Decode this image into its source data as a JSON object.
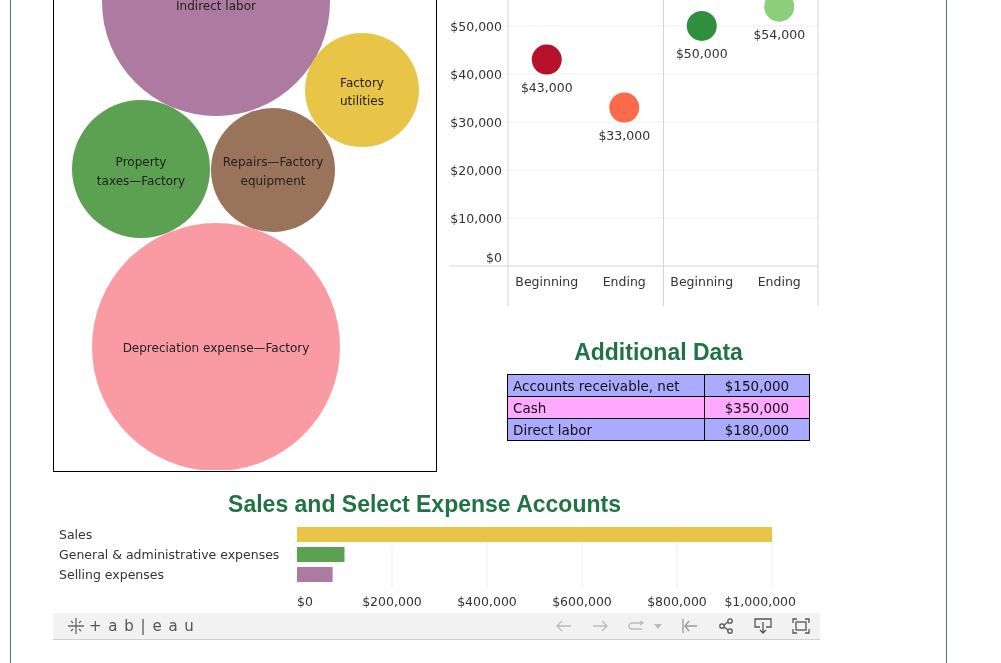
{
  "bubble_chart": {
    "bubbles": [
      {
        "label": "Indirect labor",
        "color": "#ad7aa1"
      },
      {
        "label": "Factory utilities",
        "color": "#e8c547"
      },
      {
        "label": "Property taxes—Factory",
        "color": "#5ba151"
      },
      {
        "label": "Repairs—Factory equipment",
        "color": "#9a735b"
      },
      {
        "label": "Depreciation expense—Factory",
        "color": "#fa9ba4"
      }
    ]
  },
  "balance_chart": {
    "chart_data": {
      "type": "scatter",
      "categories": [
        "Beginning",
        "Ending",
        "Beginning",
        "Ending"
      ],
      "ylim": [
        0,
        55400
      ],
      "yticks": [
        {
          "value": 0,
          "label": "$0"
        },
        {
          "value": 10000,
          "label": "$10,000"
        },
        {
          "value": 20000,
          "label": "$20,000"
        },
        {
          "value": 30000,
          "label": "$30,000"
        },
        {
          "value": 40000,
          "label": "$40,000"
        },
        {
          "value": 50000,
          "label": "$50,000"
        }
      ],
      "series": [
        {
          "color": "#b5112a",
          "values": [
            43000,
            null,
            null,
            null
          ]
        },
        {
          "color": "#fb6a4a",
          "values": [
            null,
            33000,
            null,
            null
          ]
        },
        {
          "color": "#2f8f3e",
          "values": [
            null,
            null,
            50000,
            null
          ]
        },
        {
          "color": "#8ccf7a",
          "values": [
            null,
            null,
            null,
            54000
          ]
        }
      ],
      "value_labels": [
        "$43,000",
        "$33,000",
        "$50,000",
        "$54,000"
      ],
      "grid": true
    }
  },
  "additional_data": {
    "title": "Additional Data",
    "rows": [
      {
        "label": "Accounts receivable, net",
        "value": "$150,000",
        "color": "#aaaaff"
      },
      {
        "label": "Cash",
        "value": "$350,000",
        "color": "#ffaaff"
      },
      {
        "label": "Direct labor",
        "value": "$180,000",
        "color": "#aaaaff"
      }
    ]
  },
  "sales_chart": {
    "chart_data": {
      "type": "bar",
      "orientation": "horizontal",
      "title": "Sales and Select Expense Accounts",
      "grid": true,
      "categories": [
        "Sales",
        "General & administrative expenses",
        "Selling expenses"
      ],
      "series": [
        {
          "color": "#e8c547",
          "values": [
            1000000,
            null,
            null
          ]
        },
        {
          "color": "#5ba151",
          "values": [
            null,
            100000,
            null
          ]
        },
        {
          "color": "#ad7aa1",
          "values": [
            null,
            null,
            75000
          ]
        }
      ],
      "xlim": [
        0,
        1000000
      ],
      "xticks": [
        {
          "value": 0,
          "label": "$0"
        },
        {
          "value": 200000,
          "label": "$200,000"
        },
        {
          "value": 400000,
          "label": "$400,000"
        },
        {
          "value": 600000,
          "label": "$600,000"
        },
        {
          "value": 800000,
          "label": "$800,000"
        },
        {
          "value": 1000000,
          "label": "$1,000,000"
        }
      ]
    }
  },
  "toolbar": {
    "logo_text": "+ a b | e a u"
  }
}
